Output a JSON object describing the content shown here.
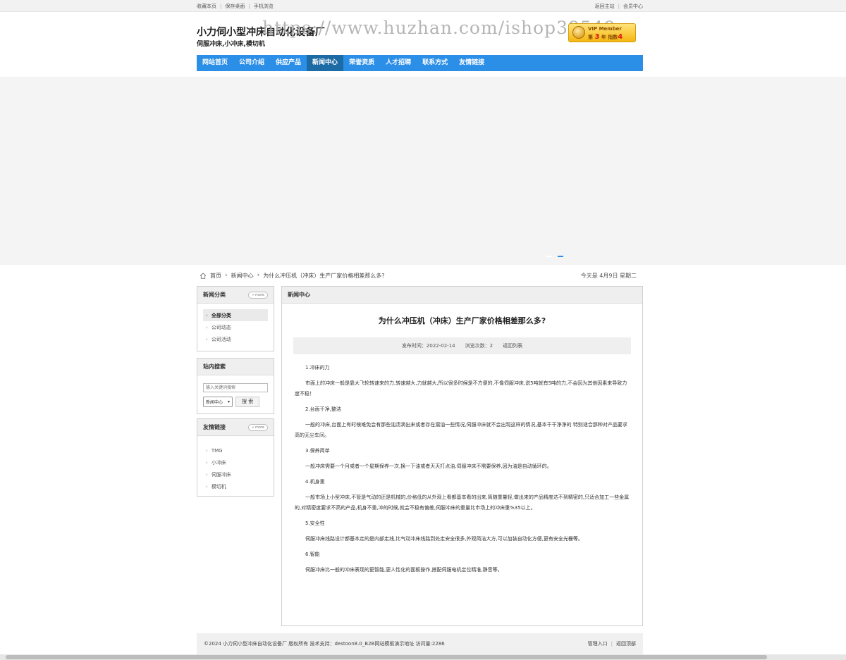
{
  "topbar": {
    "left_links": [
      "收藏本页",
      "保存桌面",
      "手机浏览"
    ],
    "right_links": [
      "返回主站",
      "会员中心"
    ]
  },
  "header": {
    "title": "小力伺小型冲床自动化设备厂",
    "subtitle": "伺服冲床,小冲床,模切机",
    "watermark": "https://www.huzhan.com/ishop39549",
    "vip": {
      "label": "VIP Member",
      "prefix": "第",
      "year_num": "3",
      "year_unit": "年",
      "index_label": "指数",
      "index_num": "4"
    }
  },
  "nav": {
    "items": [
      "网站首页",
      "公司介绍",
      "供应产品",
      "新闻中心",
      "荣誉资质",
      "人才招聘",
      "联系方式",
      "友情链接"
    ],
    "active": "新闻中心"
  },
  "breadcrumb": {
    "home": "首页",
    "section": "新闻中心",
    "current": "为什么冲压机（冲床）生产厂家价格相差那么多?",
    "date": "今天是 4月9日 星期二"
  },
  "sidebar": {
    "categories": {
      "title": "新闻分类",
      "more": "more",
      "items": [
        "全部分类",
        "公司动态",
        "公司活动"
      ]
    },
    "search": {
      "title": "站内搜索",
      "placeholder": "输入关键词搜索",
      "select_value": "新闻中心",
      "button": "搜 索"
    },
    "links": {
      "title": "友情链接",
      "more": "more",
      "items": [
        "TMG",
        "小冲床",
        "伺服冲床",
        "模切机"
      ]
    }
  },
  "article": {
    "panel_title": "新闻中心",
    "title": "为什么冲压机（冲床）生产厂家价格相差那么多?",
    "publish_time": "发布时间：2022-02-14",
    "views": "浏览次数：2",
    "back": "返回列表",
    "paragraphs": [
      "1.冲床的力",
      "市面上的冲床一般是靠大飞轮转速来的力,转速越大,力就越大,所以很多时候是不方便的,不像伺服冲床,说5吨就有5吨的力,不会因为其他因素来导致力度不稳！",
      "2.台面干净,整洁",
      "一般的冲床,台面上有时候难免会有那些油渍滴出来或者存在漏油一些情况,伺服冲床就不会出现这样的情况,基本干干净净的 特别适合那种对产品要求高的无尘车间。",
      "3.保养简单",
      "一般冲床需要一个月或者一个星期保养一次,换一下油或者天天打点油,伺服冲床不需要保养,因为油是自动循环的。",
      "4.机身重",
      "一般市场上小型冲床,不管是气动的还是机械的,价格低的从外观上看都基本看的出来,简随重量轻,做出来的产品精度达不到精密的,只适合加工一些金属的,对精密度要求不高的产品,机身不重,冲的时候,就会不稳有偏差,伺服冲床的重量比市场上的冲床重%35以上。",
      "5.安全性",
      "伺服冲床线路设计都基本走的是内部走线,比气动冲床线路到处走安全很多,外观简洁大方,可以加装自动化方便,更有安全光栅等。",
      "6.智能",
      "伺服冲床比一般的冲床表现的更智能,更人性化的面板操作,搭配伺服电机定位精准,静音等。"
    ]
  },
  "footer": {
    "copyright": "©2024 小力伺小型冲床自动化设备厂 版权所有   技术支持：destoon8.0_B2B网站模板演示地址   访问量:2286",
    "right_links": [
      "管理入口",
      "返回顶部"
    ]
  }
}
